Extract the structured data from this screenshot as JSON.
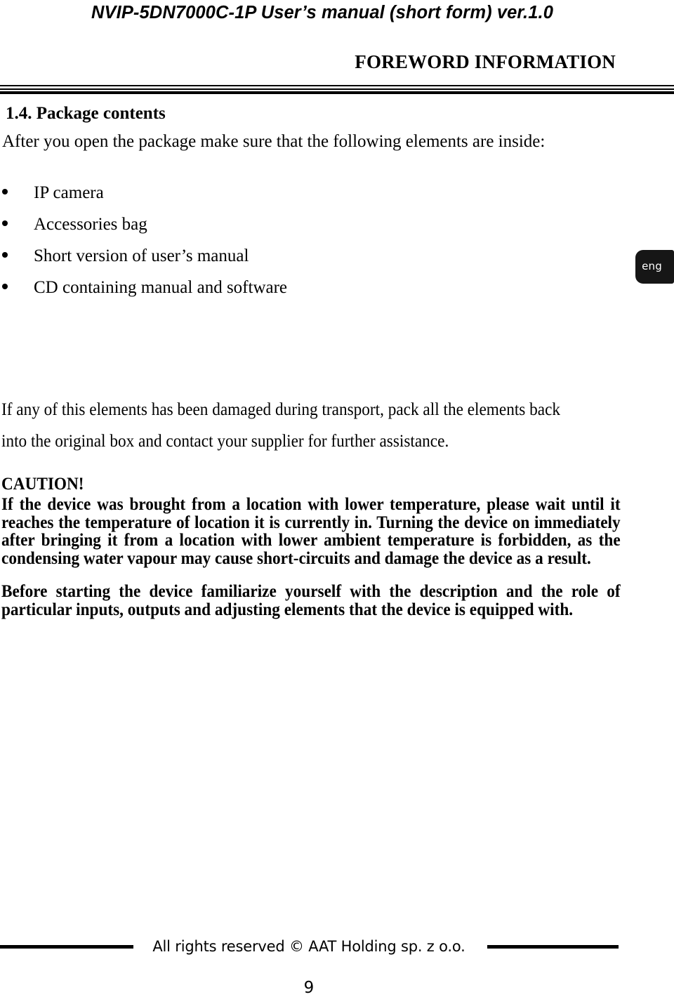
{
  "header": {
    "running_title": "NVIP-5DN7000C-1P  User’s manual (short form) ver.1.0",
    "chapter_title": "FOREWORD INFORMATION"
  },
  "language_tab": {
    "label": "eng",
    "background_color": "#161616",
    "text_color": "#ffffff"
  },
  "section": {
    "heading": "1.4. Package contents",
    "intro": "After you open the package make sure that the following elements are inside:",
    "items": [
      {
        "label": "IP camera"
      },
      {
        "label": "Accessories bag"
      },
      {
        "label": "Short version of user’s manual"
      },
      {
        "label": "CD containing manual and software"
      }
    ],
    "note": "If any of this elements has been damaged during transport, pack all the elements back into the original box and contact your supplier for further assistance."
  },
  "caution": {
    "heading": "CAUTION!",
    "body": "If the device was brought from a location with lower temperature, please wait until it reaches the temperature of location it is currently in. Turning the device on immediately after bringing it from a location with lower ambient temperature is forbidden, as the condensing water vapour may cause short-circuits and damage the device as a result."
  },
  "before_starting": {
    "body": "Before starting the device familiarize yourself with the description and the role of particular inputs, outputs and adjusting elements that the device is equipped with."
  },
  "footer": {
    "copyright": "All rights reserved © AAT Holding sp. z o.o.",
    "page_number": "9"
  }
}
